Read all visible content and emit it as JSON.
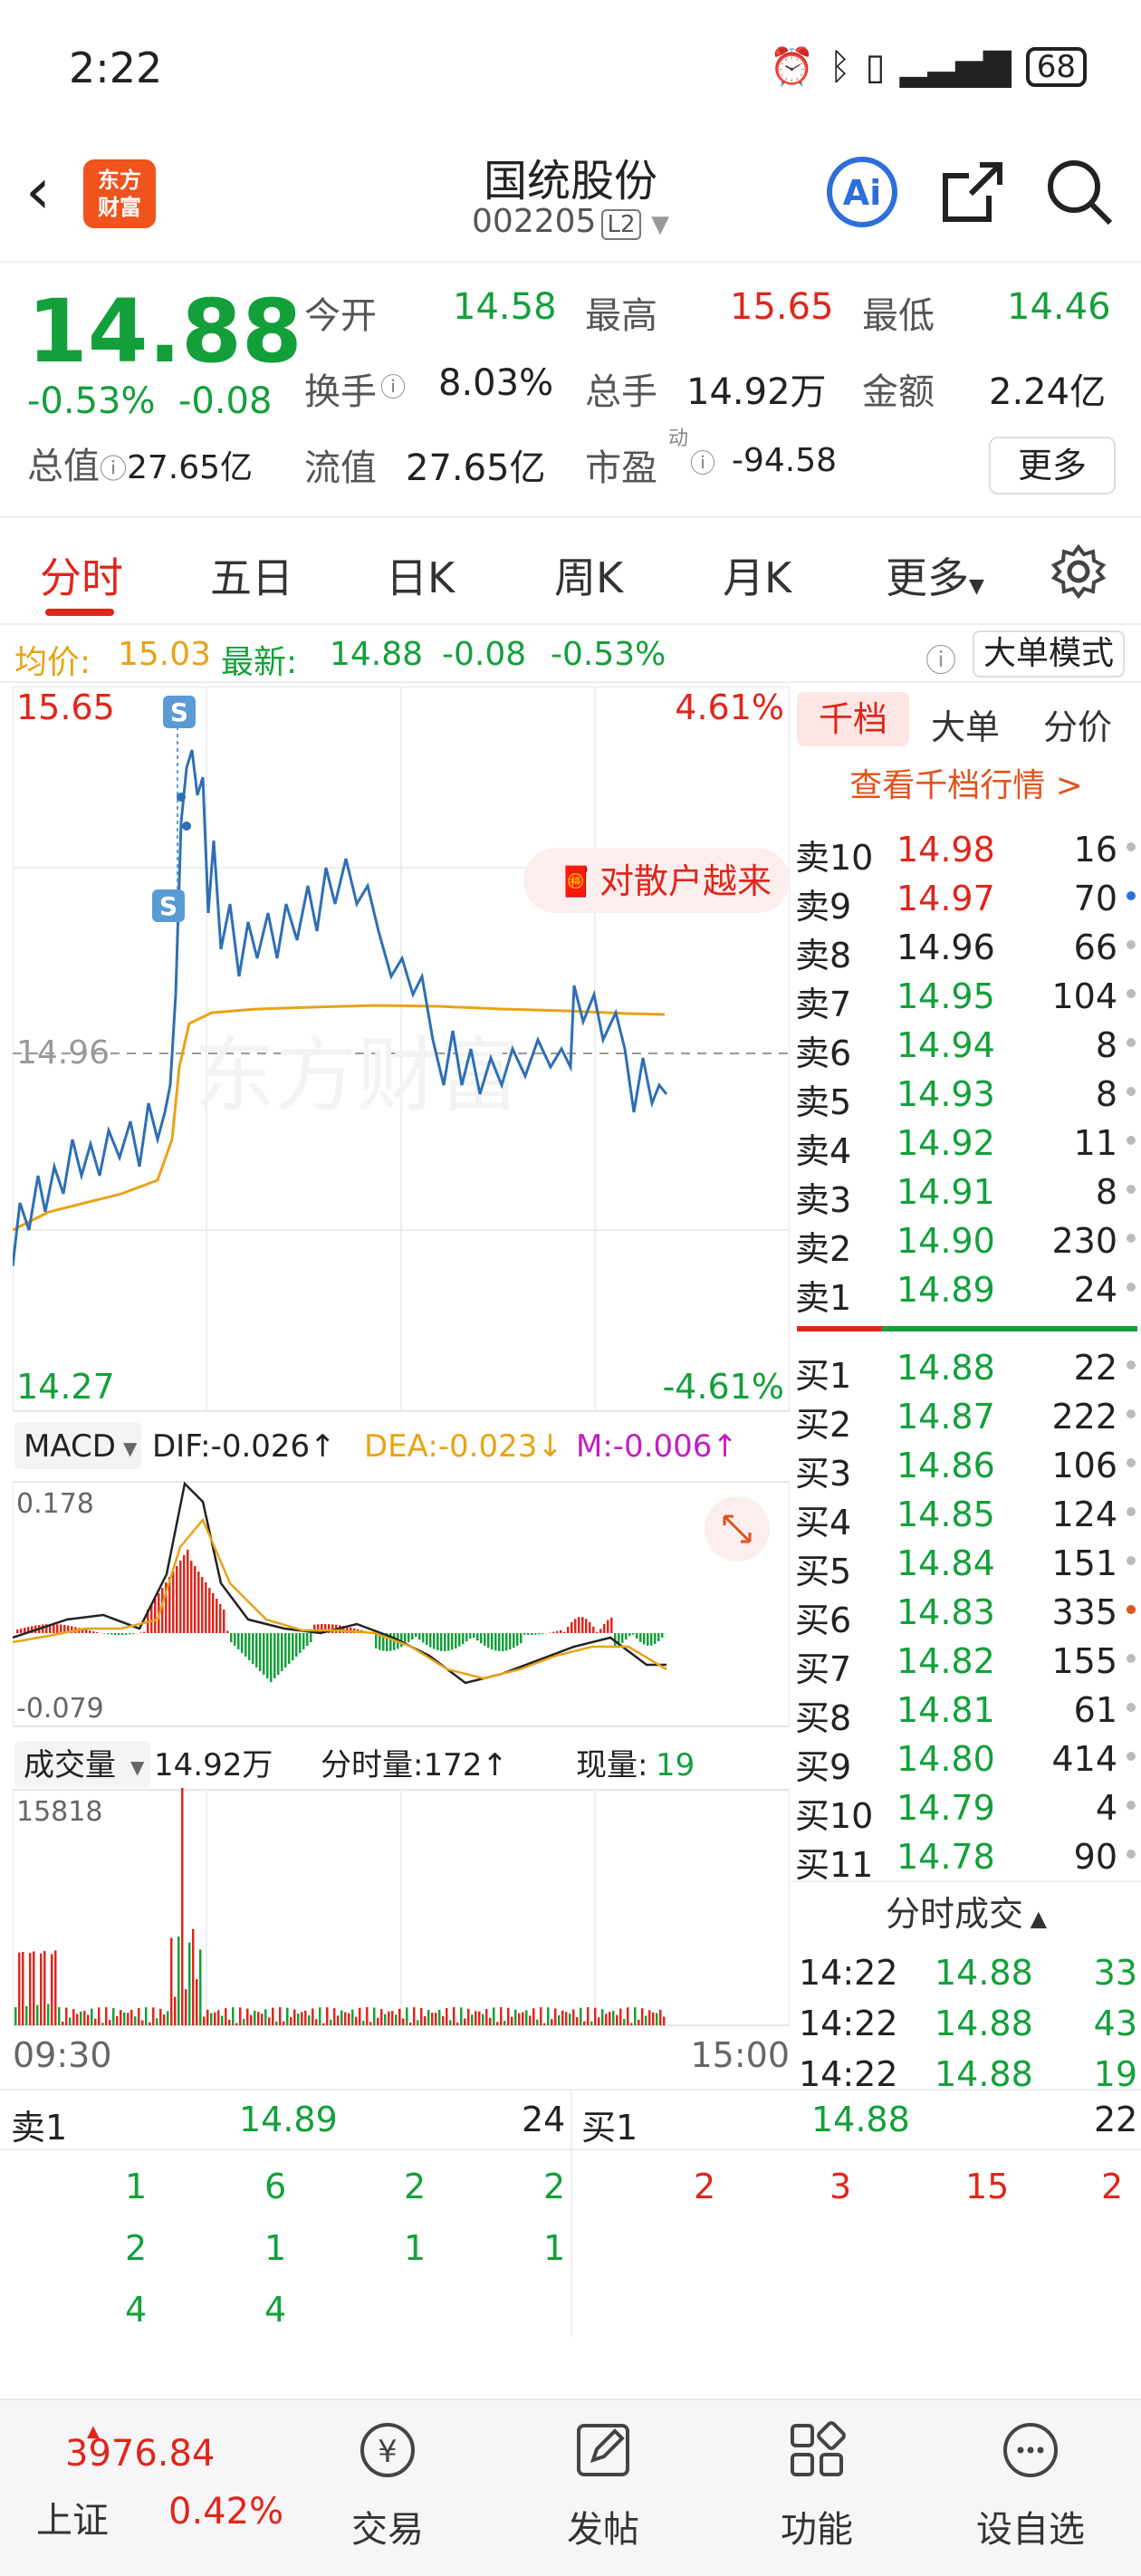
{
  "status": {
    "time": "2:22",
    "battery": "68"
  },
  "header": {
    "title": "国统股份",
    "code": "002205",
    "level": "L2",
    "logo_line1": "东方",
    "logo_line2": "财富"
  },
  "quote": {
    "price": "14.88",
    "change_pct": "-0.53%",
    "change": "-0.08",
    "open_label": "今开",
    "open": "14.58",
    "high_label": "最高",
    "high": "15.65",
    "low_label": "最低",
    "low": "14.46",
    "turnover_label": "换手",
    "turnover": "8.03%",
    "volume_label": "总手",
    "volume": "14.92万",
    "amount_label": "金额",
    "amount": "2.24亿",
    "total_cap_label": "总值",
    "total_cap": "27.65亿",
    "float_cap_label": "流值",
    "float_cap": "27.65亿",
    "pe_label": "市盈",
    "pe_sup": "动",
    "pe": "-94.58",
    "more": "更多"
  },
  "tabs": [
    "分时",
    "五日",
    "日K",
    "周K",
    "月K",
    "更多"
  ],
  "infobar": {
    "avg_label": "均价:",
    "avg": "15.03",
    "latest_label": "最新:",
    "latest": "14.88",
    "chg": "-0.08",
    "pct": "-0.53%",
    "mode_btn": "大单模式"
  },
  "chart": {
    "price_high": "15.65",
    "price_low": "14.27",
    "pct_high": "4.61%",
    "pct_low": "-4.61%",
    "ref_price": "14.96",
    "watermark": "东方财富",
    "banner": "对散户越来",
    "macd_label": "MACD",
    "dif": "DIF:-0.026↑",
    "dea": "DEA:-0.023↓",
    "m": "M:-0.006↑",
    "macd_max": "0.178",
    "macd_min": "-0.079",
    "vol_label": "成交量",
    "vol_total": "14.92万",
    "vol_minute": "分时量:172↑",
    "now_label": "现量:",
    "now_vol": "19",
    "vol_max": "15818",
    "time_start": "09:30",
    "time_end": "15:00",
    "s_marker": "S"
  },
  "chart_data": {
    "type": "line",
    "title": "",
    "x_range": [
      "09:30",
      "15:00"
    ],
    "ylim": [
      14.27,
      15.65
    ],
    "reference": 14.96,
    "series": []
  },
  "side": {
    "tabs": [
      "千档",
      "大单",
      "分价"
    ],
    "link": "查看千档行情 >",
    "sells": [
      {
        "label": "卖10",
        "price": "14.98",
        "qty": "16",
        "pc": "red"
      },
      {
        "label": "卖9",
        "price": "14.97",
        "qty": "70",
        "pc": "red"
      },
      {
        "label": "卖8",
        "price": "14.96",
        "qty": "66",
        "pc": "dark"
      },
      {
        "label": "卖7",
        "price": "14.95",
        "qty": "104",
        "pc": "green"
      },
      {
        "label": "卖6",
        "price": "14.94",
        "qty": "8",
        "pc": "green"
      },
      {
        "label": "卖5",
        "price": "14.93",
        "qty": "8",
        "pc": "green"
      },
      {
        "label": "卖4",
        "price": "14.92",
        "qty": "11",
        "pc": "green"
      },
      {
        "label": "卖3",
        "price": "14.91",
        "qty": "8",
        "pc": "green"
      },
      {
        "label": "卖2",
        "price": "14.90",
        "qty": "230",
        "pc": "green"
      },
      {
        "label": "卖1",
        "price": "14.89",
        "qty": "24",
        "pc": "green"
      }
    ],
    "buys": [
      {
        "label": "买1",
        "price": "14.88",
        "qty": "22"
      },
      {
        "label": "买2",
        "price": "14.87",
        "qty": "222"
      },
      {
        "label": "买3",
        "price": "14.86",
        "qty": "106"
      },
      {
        "label": "买4",
        "price": "14.85",
        "qty": "124"
      },
      {
        "label": "买5",
        "price": "14.84",
        "qty": "151"
      },
      {
        "label": "买6",
        "price": "14.83",
        "qty": "335"
      },
      {
        "label": "买7",
        "price": "14.82",
        "qty": "155"
      },
      {
        "label": "买8",
        "price": "14.81",
        "qty": "61"
      },
      {
        "label": "买9",
        "price": "14.80",
        "qty": "414"
      },
      {
        "label": "买10",
        "price": "14.79",
        "qty": "4"
      },
      {
        "label": "买11",
        "price": "14.78",
        "qty": "90"
      }
    ],
    "ticks_title": "分时成交",
    "ticks": [
      {
        "time": "14:22",
        "price": "14.88",
        "qty": "33"
      },
      {
        "time": "14:22",
        "price": "14.88",
        "qty": "43"
      },
      {
        "time": "14:22",
        "price": "14.88",
        "qty": "19"
      }
    ]
  },
  "queue": {
    "sell_label": "卖1",
    "sell_price": "14.89",
    "sell_qty": "24",
    "buy_label": "买1",
    "buy_price": "14.88",
    "buy_qty": "22",
    "sell_rows": [
      [
        "1",
        "6",
        "2",
        "2"
      ],
      [
        "2",
        "1",
        "1",
        "1"
      ],
      [
        "4",
        "4"
      ]
    ],
    "buy_rows": [
      [
        "2",
        "3",
        "15",
        "2"
      ]
    ]
  },
  "nav": {
    "index_value": "3976.84",
    "index_name": "上证",
    "index_pct": "0.42%",
    "items": [
      "交易",
      "发帖",
      "功能",
      "设自选"
    ]
  },
  "colors": {
    "up": "#e0261b",
    "down": "#13a03a",
    "avg_line": "#e8a317",
    "price_line": "#2d6fb5"
  }
}
